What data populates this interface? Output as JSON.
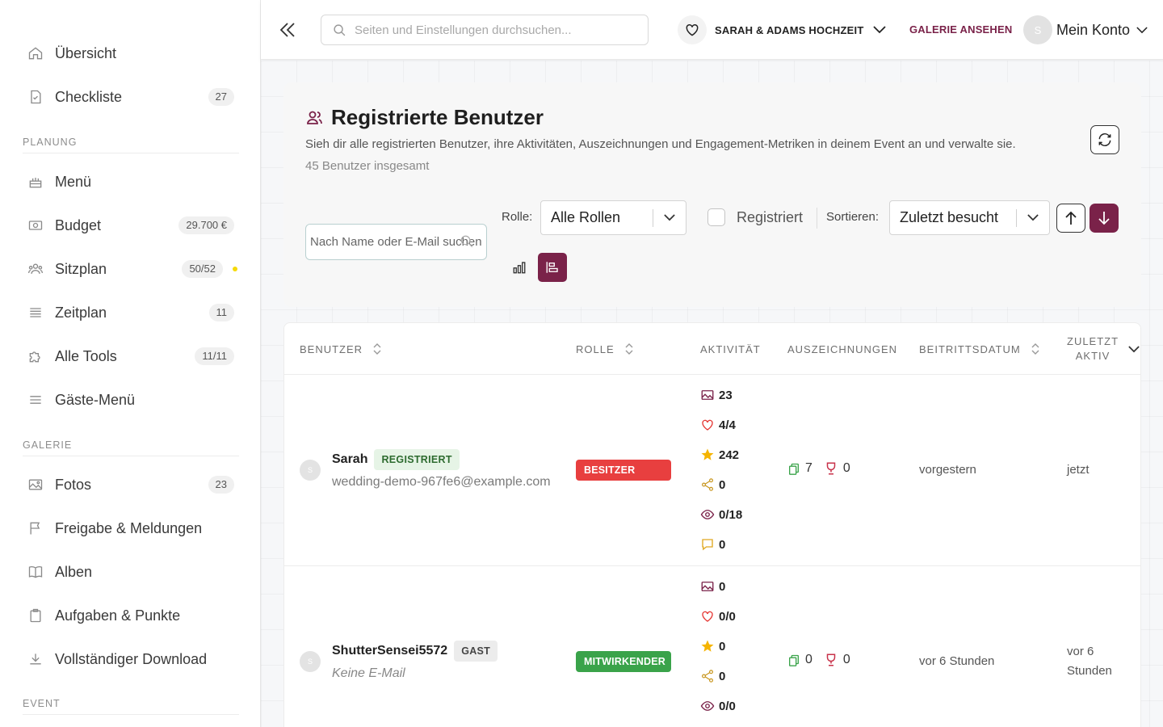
{
  "sidebar": {
    "items": [
      {
        "label": "Übersicht",
        "badge": ""
      },
      {
        "label": "Checkliste",
        "badge": "27"
      },
      {
        "label": "Menü",
        "badge": ""
      },
      {
        "label": "Budget",
        "badge": "29.700 €"
      },
      {
        "label": "Sitzplan",
        "badge": "50/52"
      },
      {
        "label": "Zeitplan",
        "badge": "11"
      },
      {
        "label": "Alle Tools",
        "badge": "11/11"
      },
      {
        "label": "Gäste-Menü",
        "badge": ""
      },
      {
        "label": "Fotos",
        "badge": "23"
      },
      {
        "label": "Freigabe & Meldungen",
        "badge": ""
      },
      {
        "label": "Alben",
        "badge": ""
      },
      {
        "label": "Aufgaben & Punkte",
        "badge": ""
      },
      {
        "label": "Vollständiger Download",
        "badge": ""
      }
    ],
    "sections": {
      "planning": "PLANUNG",
      "gallery": "GALERIE",
      "event": "EVENT"
    },
    "sitzplan_dot_color": "#f5d90a"
  },
  "topbar": {
    "search_placeholder": "Seiten und Einstellungen durchsuchen...",
    "event_name": "SARAH & ADAMS HOCHZEIT",
    "gallery_link": "GALERIE ANSEHEN",
    "account_initial": "S",
    "account_label": "Mein Konto"
  },
  "header": {
    "title": "Registrierte Benutzer",
    "subtitle": "Sieh dir alle registrierten Benutzer, ihre Aktivitäten, Auszeichnungen und Engagement-Metriken in deinem Event an und verwalte sie.",
    "total": "45 Benutzer insgesamt"
  },
  "filters": {
    "name_placeholder": "Nach Name oder E-Mail suchen",
    "role_label": "Rolle:",
    "role_value": "Alle Rollen",
    "registered_label": "Registriert",
    "sort_label": "Sortieren:",
    "sort_value": "Zuletzt besucht"
  },
  "table": {
    "headers": {
      "user": "BENUTZER",
      "role": "ROLLE",
      "activity": "AKTIVITÄT",
      "awards": "AUSZEICHNUNGEN",
      "joined": "BEITRITTSDATUM",
      "last_active_1": "ZULETZT",
      "last_active_2": "AKTIV"
    },
    "rows": [
      {
        "initial": "S",
        "name": "Sarah",
        "status": "REGISTRIERT",
        "email": "wedding-demo-967fe6@example.com",
        "role": "BESITZER",
        "activity": {
          "photos": "23",
          "likes": "4/4",
          "points": "242",
          "shares": "0",
          "views": "0/18",
          "comments": "0"
        },
        "awards": {
          "badges": "7",
          "trophies": "0"
        },
        "joined": "vorgestern",
        "last_active": "jetzt"
      },
      {
        "initial": "S",
        "name": "ShutterSensei5572",
        "status": "GAST",
        "email": "Keine E-Mail",
        "role": "MITWIRKENDER",
        "activity": {
          "photos": "0",
          "likes": "0/0",
          "points": "0",
          "shares": "0",
          "views": "0/0"
        },
        "awards": {
          "badges": "0",
          "trophies": "0"
        },
        "joined": "vor 6 Stunden",
        "last_active_1": "vor 6",
        "last_active_2": "Stunden"
      }
    ]
  },
  "colors": {
    "accent": "#7a2249",
    "owner": "#e83f3f",
    "contributor": "#3aa34a"
  }
}
